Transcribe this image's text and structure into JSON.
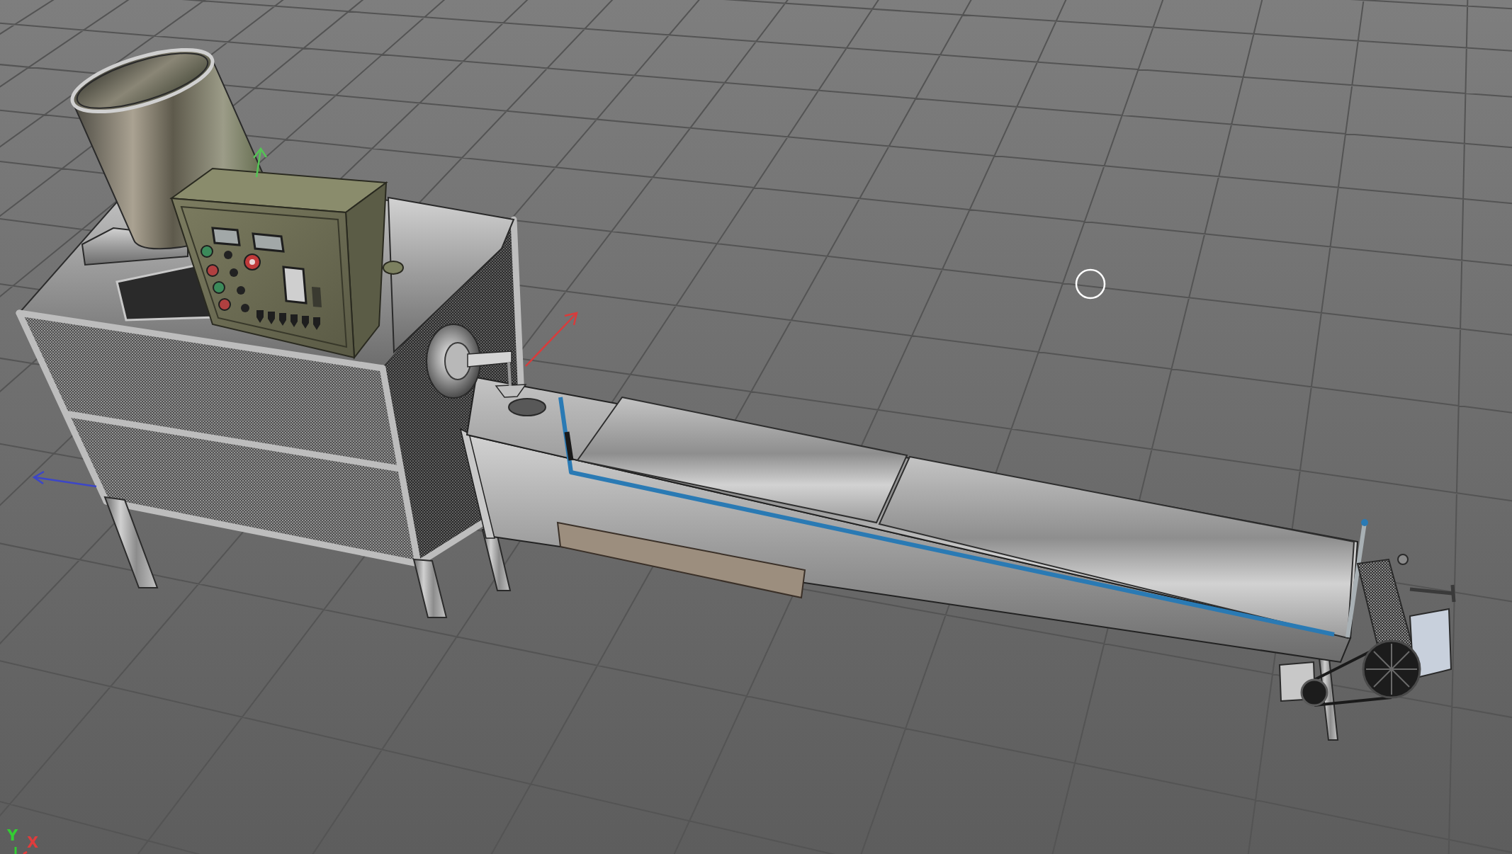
{
  "viewport": {
    "view_axes": [
      {
        "label": "Y",
        "color": "#33cc33"
      },
      {
        "label": "X",
        "color": "#e03c3c"
      }
    ]
  }
}
